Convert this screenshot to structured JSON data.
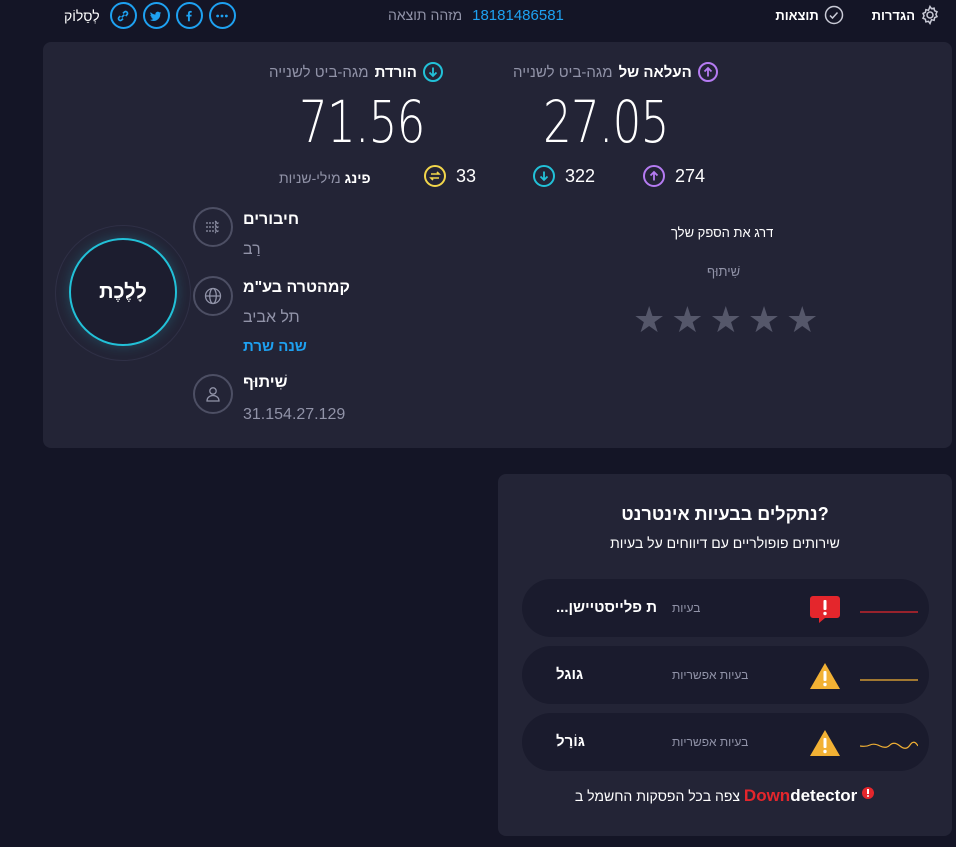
{
  "topbar": {
    "share_label": "לְסַלוֹק",
    "result_id_label": "מזהה תוצאה",
    "result_id": "18181486581",
    "results_label": "תוצאות",
    "settings_label": "הגדרות"
  },
  "results": {
    "download": {
      "unit": "מגה-ביט לשנייה",
      "label": "הורדת",
      "value": "71.56"
    },
    "upload": {
      "unit": "מגה-ביט לשנייה",
      "label": "העלאה של",
      "value": "27.05"
    },
    "ping": {
      "unit": "מילי-שניות",
      "label": "פינג",
      "idle": "33",
      "download": "322",
      "upload": "274"
    }
  },
  "go_button": "לָלֶכֶת",
  "connections": {
    "title": "חיבורים",
    "value": "רַב"
  },
  "server": {
    "title": "קמהטרה בע\"מ",
    "location": "תל אביב",
    "change_link": "שנה שרת"
  },
  "provider": {
    "title": "שִׁיתוּף",
    "ip": "31.154.27.129"
  },
  "rating": {
    "title": "דרג את הספק שלך",
    "share": "שִׁיתוּף",
    "stars": 5
  },
  "downdetector": {
    "title": "נתקלים בבעיות אינטרנט?",
    "subtitle": "שירותים פופולריים עם דיווחים על בעיות",
    "rows": [
      {
        "name": "...ת פלייסטיישן",
        "status": "בעיות",
        "level": "problem",
        "color": "#e4262c"
      },
      {
        "name": "גוגל",
        "status": "בעיות אפשריות",
        "level": "possible",
        "color": "#f2b134"
      },
      {
        "name": "גּוֹרָל",
        "status": "בעיות אפשריות",
        "level": "possible",
        "color": "#f2b134"
      }
    ],
    "footer_text": "צפה בכל הפסקות החשמל ב",
    "logo_down": "Down",
    "logo_detector": "detector"
  },
  "colors": {
    "accent": "#1ea1f1",
    "download": "#22c1d8",
    "upload": "#b57bf2",
    "ping": "#f2d64b"
  }
}
